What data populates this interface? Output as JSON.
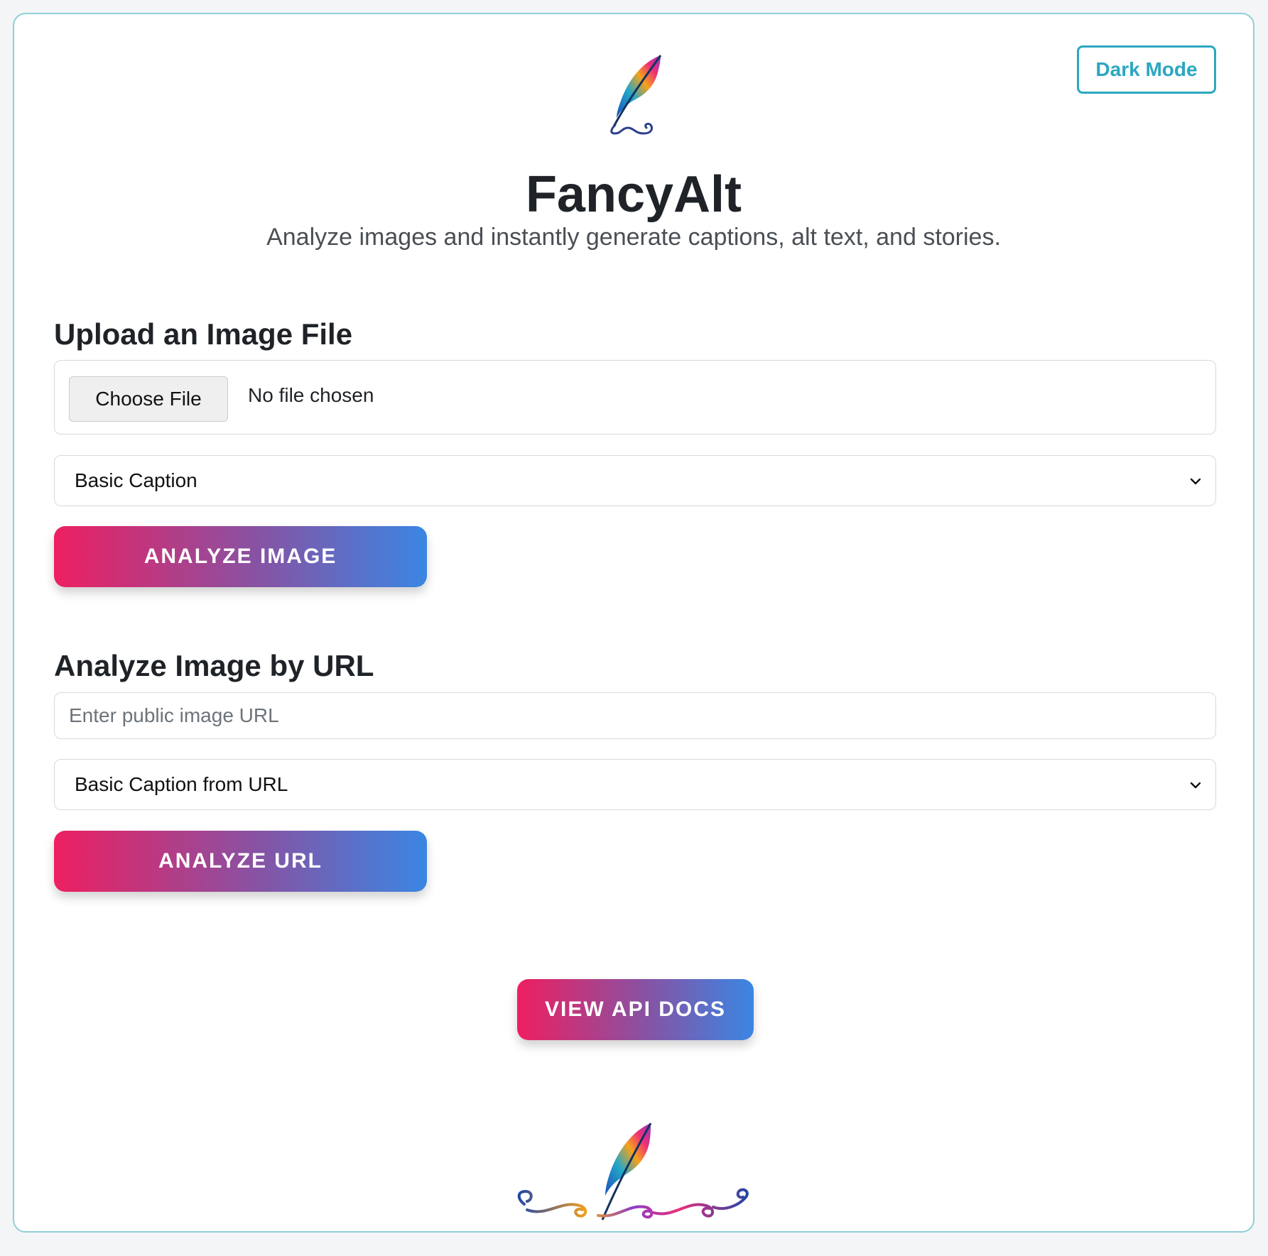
{
  "header": {
    "dark_mode_label": "Dark Mode",
    "title": "FancyAlt",
    "subtitle": "Analyze images and instantly generate captions, alt text, and stories."
  },
  "upload_section": {
    "heading": "Upload an Image File",
    "choose_file_label": "Choose File",
    "file_status": "No file chosen",
    "mode_selected": "Basic Caption",
    "analyze_label": "ANALYZE IMAGE"
  },
  "url_section": {
    "heading": "Analyze Image by URL",
    "url_placeholder": "Enter public image URL",
    "mode_selected": "Basic Caption from URL",
    "analyze_label": "ANALYZE URL"
  },
  "footer": {
    "api_docs_label": "VIEW API DOCS"
  },
  "icons": {
    "logo": "feather-quill-icon",
    "select_arrow": "chevron-down-icon"
  },
  "colors": {
    "accent_teal": "#2ba7c0",
    "gradient_start": "#ee1f60",
    "gradient_mid": "#8653a4",
    "gradient_end": "#3a86e3"
  }
}
